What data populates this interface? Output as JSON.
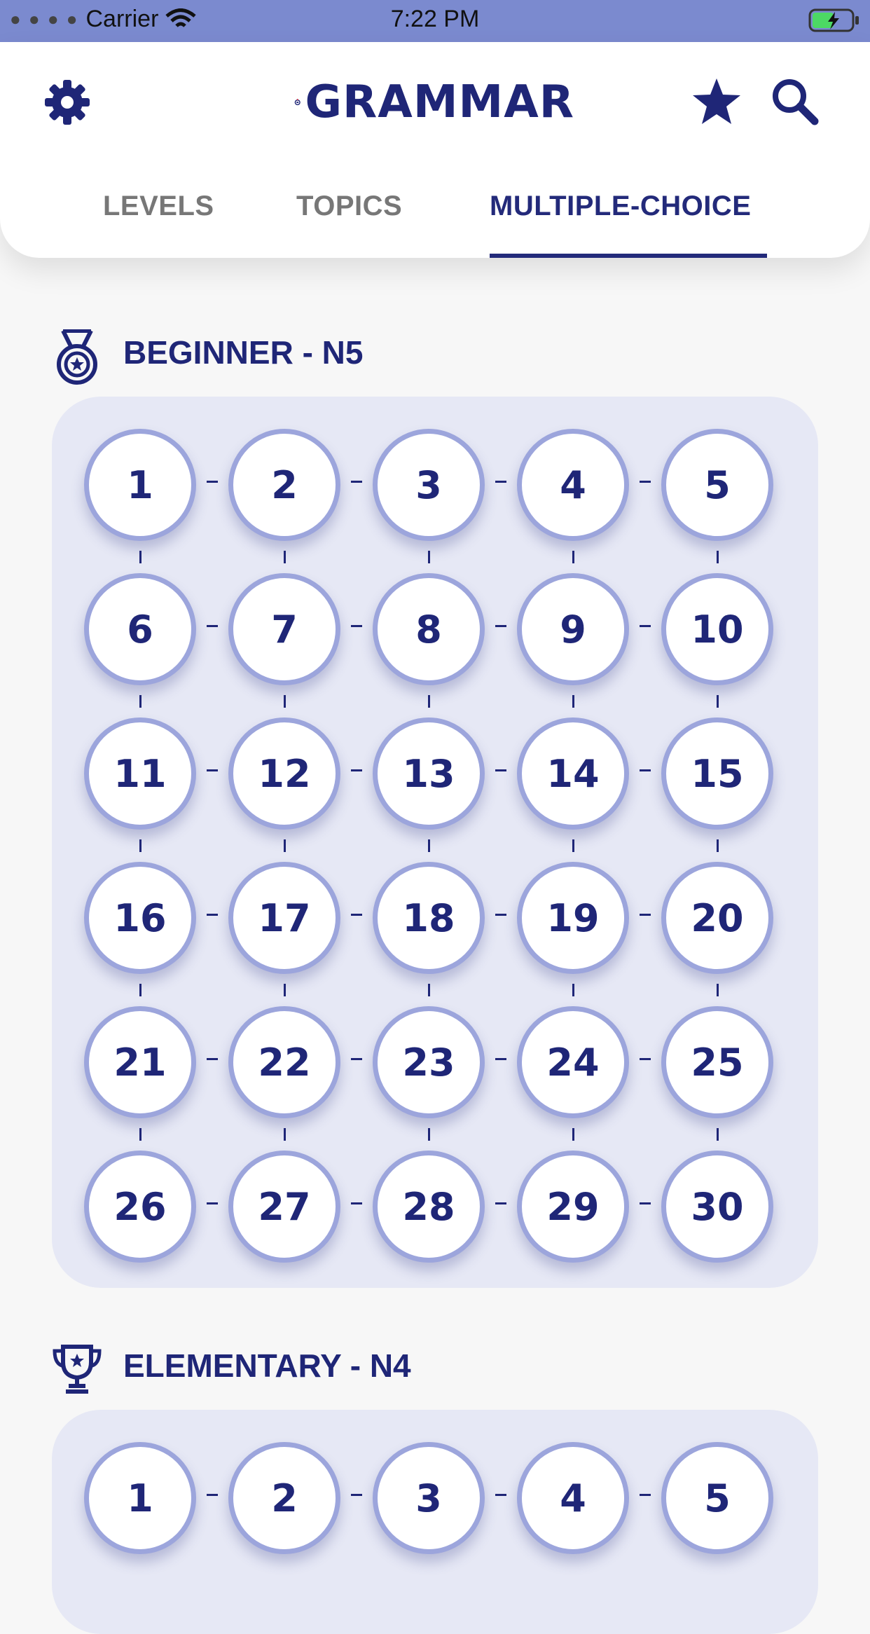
{
  "status_bar": {
    "carrier": "Carrier",
    "time": "7:22 PM"
  },
  "header": {
    "logo_text": "GRAMMAR",
    "tabs": [
      {
        "label": "LEVELS",
        "active": false
      },
      {
        "label": "TOPICS",
        "active": false
      },
      {
        "label": "MULTIPLE-CHOICE",
        "active": true
      }
    ]
  },
  "sections": [
    {
      "title": "BEGINNER - N5",
      "icon": "medal-icon",
      "items": [
        "1",
        "2",
        "3",
        "4",
        "5",
        "6",
        "7",
        "8",
        "9",
        "10",
        "11",
        "12",
        "13",
        "14",
        "15",
        "16",
        "17",
        "18",
        "19",
        "20",
        "21",
        "22",
        "23",
        "24",
        "25",
        "26",
        "27",
        "28",
        "29",
        "30"
      ]
    },
    {
      "title": "ELEMENTARY - N4",
      "icon": "trophy-icon",
      "items": [
        "1",
        "2",
        "3",
        "4",
        "5"
      ]
    }
  ],
  "colors": {
    "accent": "#1f2677",
    "status_bar": "#7b8acf",
    "node_border": "#9ca5dc",
    "panel": "#e6e8f5"
  }
}
